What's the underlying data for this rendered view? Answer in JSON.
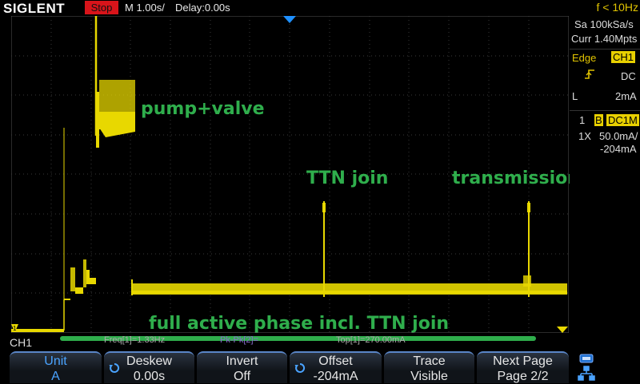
{
  "topbar": {
    "brand": "SIGLENT",
    "run_state": "Stop",
    "timebase": "M 1.00s/",
    "delay": "Delay:0.00s",
    "trigger_freq": "f < 10Hz"
  },
  "right_panel": {
    "sample_rate": "Sa 100kSa/s",
    "memory_depth": "Curr 1.40Mpts",
    "trigger_type": "Edge",
    "trigger_source": "CH1",
    "trigger_coupling": "DC",
    "trigger_level_label": "L",
    "trigger_level": "2mA",
    "channel_number": "1",
    "bandwidth_limit": "B",
    "channel_coupling": "DC1M",
    "probe": "1X",
    "scale": "50.0mA/",
    "offset": "-204mA"
  },
  "channel_label": "CH1",
  "measurements": {
    "freq": "Freq[1]=1.33Hz",
    "pkpk": "Pk-Pk[2]=",
    "top": "Top[1]=270.00mA"
  },
  "annotations": {
    "pump_valve": "pump+valve",
    "ttn_join": "TTN join",
    "transmission": "transmission",
    "full_phase": "full active phase incl. TTN join"
  },
  "softkeys": [
    {
      "title": "Unit",
      "value": "A"
    },
    {
      "title": "Deskew",
      "value": "0.00s"
    },
    {
      "title": "Invert",
      "value": "Off"
    },
    {
      "title": "Offset",
      "value": "-204mA"
    },
    {
      "title": "Trace",
      "value": "Visible"
    },
    {
      "title": "Next Page",
      "value": "Page 2/2"
    }
  ],
  "colors": {
    "trace": "#e8d800",
    "annotation": "#2fae4c",
    "trigger_marker": "#1e90ff",
    "stop_badge": "#d8141a"
  }
}
